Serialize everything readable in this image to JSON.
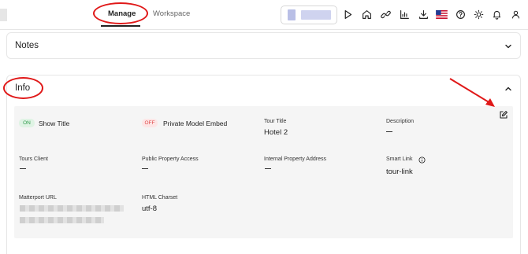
{
  "header": {
    "tabs": [
      {
        "label": "Manage",
        "active": true
      },
      {
        "label": "Workspace",
        "active": false
      }
    ],
    "icons": [
      "play-icon",
      "home-icon",
      "link-icon",
      "analytics-icon",
      "download-icon",
      "us-flag-icon",
      "help-icon",
      "brightness-icon",
      "bell-icon",
      "user-icon"
    ]
  },
  "notes": {
    "title": "Notes"
  },
  "info": {
    "title": "Info",
    "show_title": {
      "toggle": "ON",
      "label": "Show Title"
    },
    "private_embed": {
      "toggle": "OFF",
      "label": "Private Model Embed"
    },
    "tour_title": {
      "label": "Tour Title",
      "value": "Hotel 2"
    },
    "description": {
      "label": "Description"
    },
    "tours_client": {
      "label": "Tours Client"
    },
    "public_access": {
      "label": "Public Property Access"
    },
    "internal_address": {
      "label": "Internal Property Address"
    },
    "smart_link": {
      "label": "Smart Link",
      "value": "tour-link"
    },
    "matterport_url": {
      "label": "Matterport URL"
    },
    "html_charset": {
      "label": "HTML Charset",
      "value": "utf-8"
    }
  },
  "colors": {
    "annotation": "#e01818",
    "on": "#2e9b4a",
    "off": "#e04a4a"
  }
}
